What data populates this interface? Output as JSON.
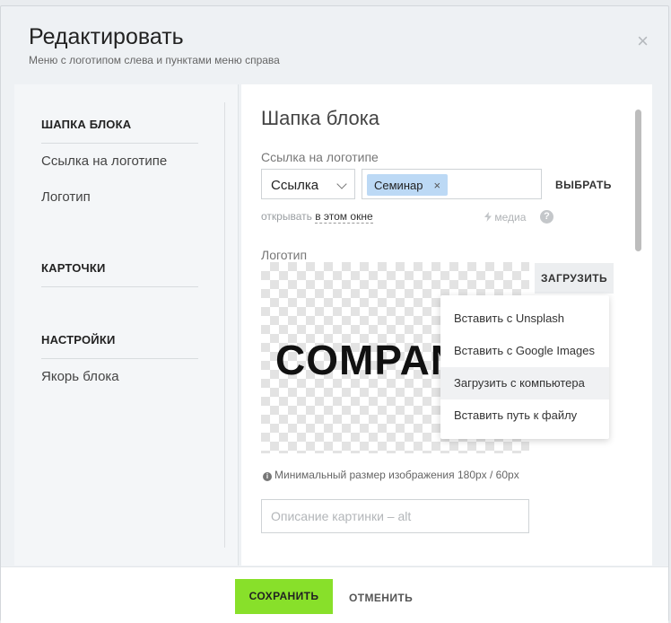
{
  "header": {
    "title": "Редактировать",
    "subtitle": "Меню с логотипом слева и пунктами меню справа",
    "close_icon": "close-icon",
    "close_glyph": "×"
  },
  "sidebar": {
    "sections": [
      {
        "title": "ШАПКА БЛОКА",
        "items": [
          "Ссылка на логотипе",
          "Логотип"
        ]
      },
      {
        "title": "КАРТОЧКИ",
        "items": []
      },
      {
        "title": "НАСТРОЙКИ",
        "items": [
          "Якорь блока"
        ]
      }
    ]
  },
  "content": {
    "title": "Шапка блока",
    "link_label": "Ссылка на логотипе",
    "link_type": "Ссылка",
    "link_tag": "Семинар",
    "tag_remove_glyph": "×",
    "choose_label": "ВЫБРАТЬ",
    "open_prefix": "открывать",
    "open_value": "в этом окне",
    "media_label": "медиа",
    "help_glyph": "?",
    "logo_label": "Логотип",
    "logo_text": "COMPANY",
    "upload_label": "ЗАГРУЗИТЬ",
    "upload_menu": [
      "Вставить с Unsplash",
      "Вставить с Google Images",
      "Загрузить с компьютера",
      "Вставить путь к файлу"
    ],
    "upload_menu_active": 2,
    "min_size_note": "Минимальный размер изображения 180px / 60px",
    "info_glyph": "i",
    "alt_placeholder": "Описание картинки – alt",
    "alt_value": ""
  },
  "footer": {
    "save_label": "СОХРАНИТЬ",
    "cancel_label": "ОТМЕНИТЬ"
  },
  "colors": {
    "save_button": "#88e02a",
    "tag_background": "#bcd9f5"
  }
}
